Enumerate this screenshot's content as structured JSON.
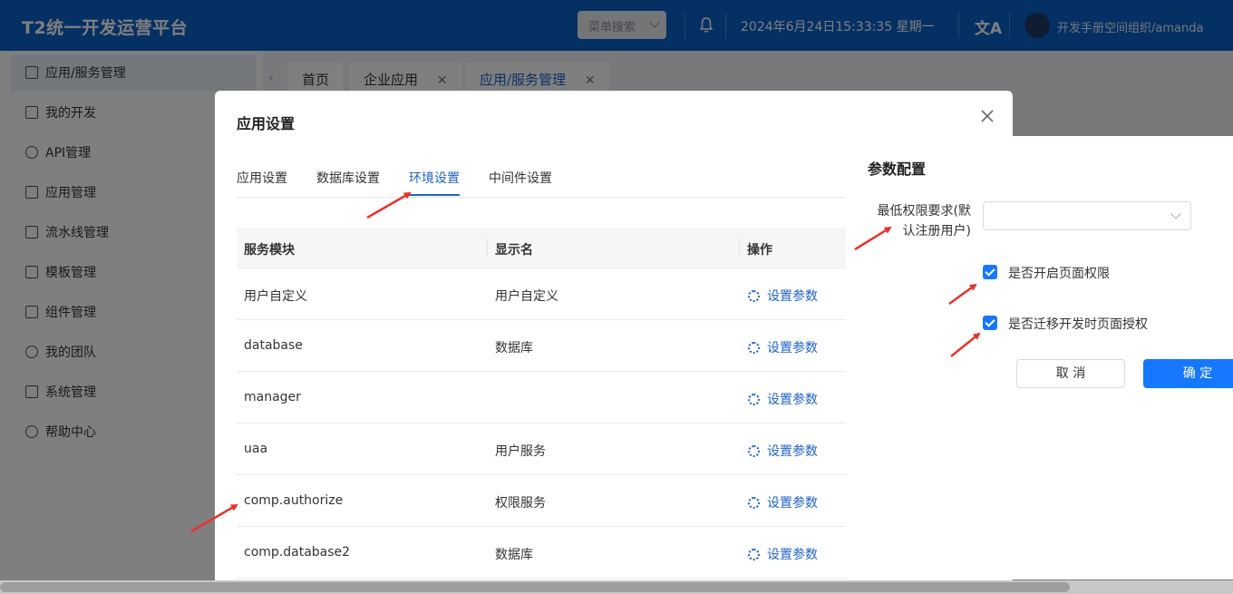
{
  "header": {
    "title": "T2统一开发运营平台",
    "menu_search": "菜单搜索",
    "datetime": "2024年6月24日15:33:35 星期一",
    "translate_glyph": "文A",
    "user": "开发手册空间组织/amanda"
  },
  "sidebar": {
    "items": [
      {
        "label": "应用/服务管理",
        "icon": "grid-icon"
      },
      {
        "label": "我的开发",
        "icon": "code-icon"
      },
      {
        "label": "API管理",
        "icon": "link-icon"
      },
      {
        "label": "应用管理",
        "icon": "apps-icon"
      },
      {
        "label": "流水线管理",
        "icon": "pipeline-icon"
      },
      {
        "label": "模板管理",
        "icon": "template-icon"
      },
      {
        "label": "组件管理",
        "icon": "component-icon"
      },
      {
        "label": "我的团队",
        "icon": "team-icon"
      },
      {
        "label": "系统管理",
        "icon": "system-icon"
      },
      {
        "label": "帮助中心",
        "icon": "help-icon"
      }
    ]
  },
  "page_tabs": [
    {
      "label": "首页"
    },
    {
      "label": "企业应用"
    },
    {
      "label": "应用/服务管理"
    }
  ],
  "modal": {
    "title": "应用设置",
    "tabs": [
      "应用设置",
      "数据库设置",
      "环境设置",
      "中间件设置"
    ],
    "active_tab": "环境设置",
    "table": {
      "headers": [
        "服务模块",
        "显示名",
        "操作"
      ],
      "rows": [
        {
          "module": "用户自定义",
          "display": "用户自定义",
          "action": "设置参数"
        },
        {
          "module": "database",
          "display": "数据库",
          "action": "设置参数"
        },
        {
          "module": "manager",
          "display": "",
          "action": "设置参数"
        },
        {
          "module": "uaa",
          "display": "用户服务",
          "action": "设置参数"
        },
        {
          "module": "comp.authorize",
          "display": "权限服务",
          "action": "设置参数"
        },
        {
          "module": "comp.database2",
          "display": "数据库",
          "action": "设置参数"
        }
      ]
    }
  },
  "param_panel": {
    "title": "参数配置",
    "field_label_line1": "最低权限要求(默",
    "field_label_line2": "认注册用户)",
    "select_value": "",
    "checkbox1": {
      "label": "是否开启页面权限",
      "checked": true
    },
    "checkbox2": {
      "label": "是否迁移开发时页面授权",
      "checked": true
    },
    "cancel": "取 消",
    "ok": "确 定"
  },
  "colors": {
    "header_bg": "#0b60c8",
    "primary": "#1677ff",
    "link": "#1e62c9",
    "arrow": "#e8322b"
  }
}
